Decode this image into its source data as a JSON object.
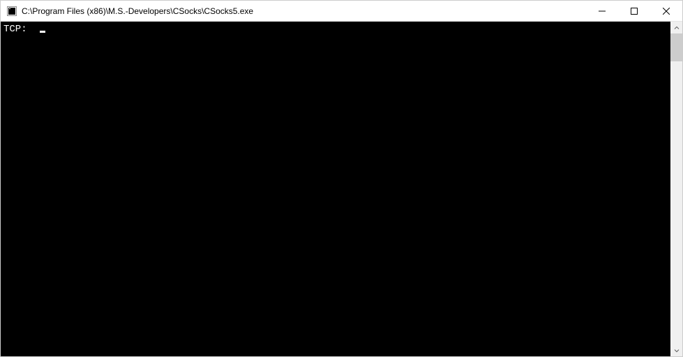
{
  "window": {
    "title": "C:\\Program Files (x86)\\M.S.-Developers\\CSocks\\CSocks5.exe"
  },
  "console": {
    "lines": [
      "TCP:"
    ]
  },
  "icons": {
    "app": "console-app-icon",
    "minimize": "minimize-icon",
    "maximize": "maximize-icon",
    "close": "close-icon",
    "scroll_up": "chevron-up-icon",
    "scroll_down": "chevron-down-icon"
  }
}
